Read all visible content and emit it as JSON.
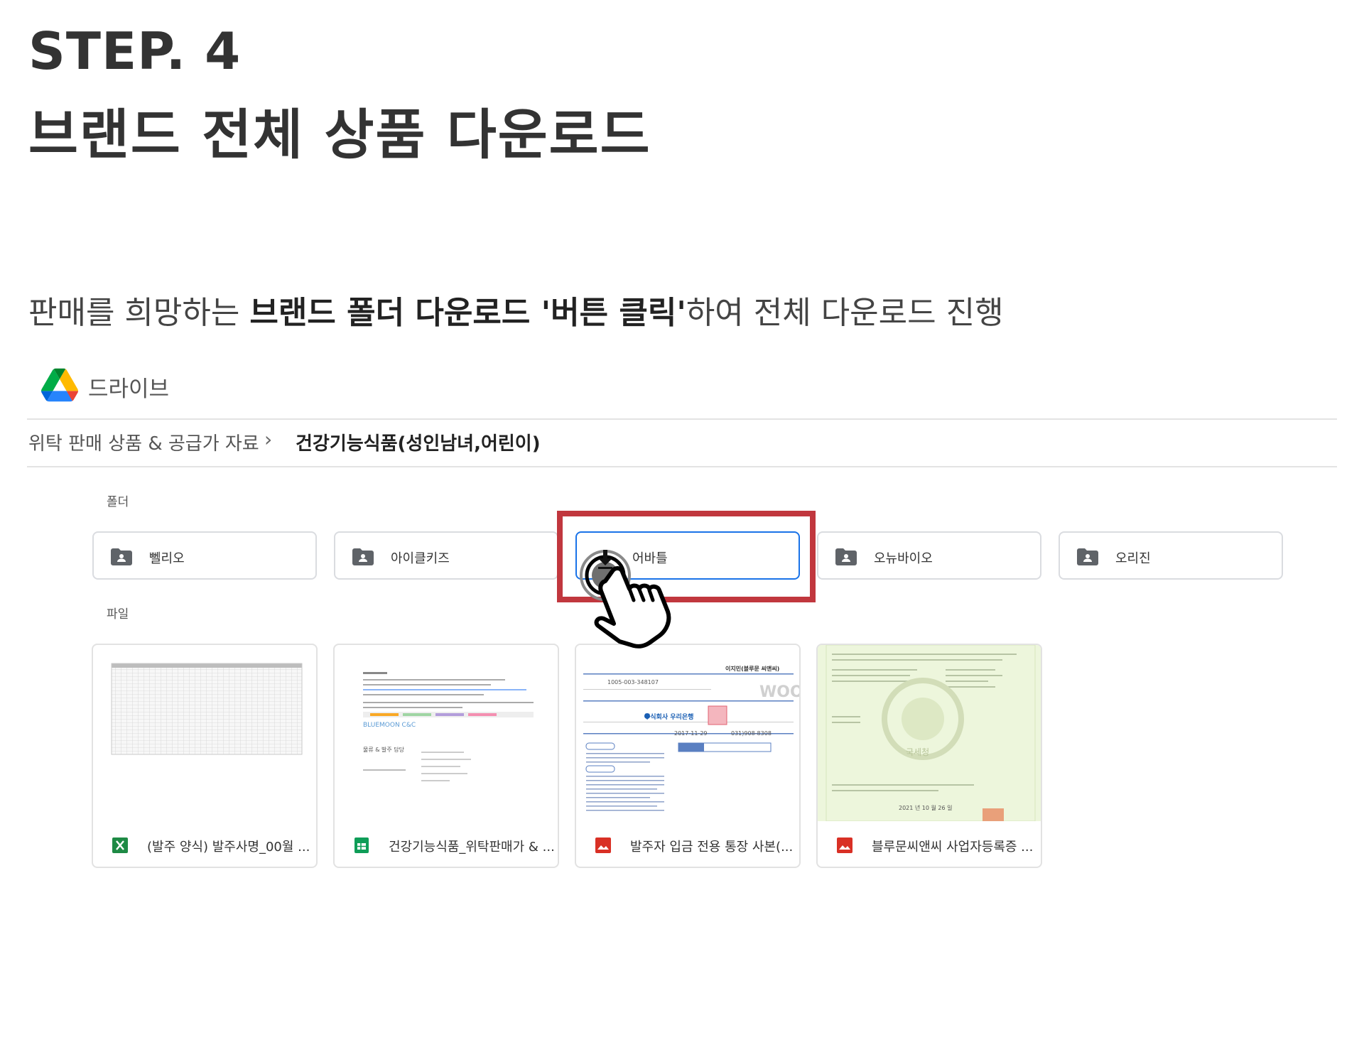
{
  "header": {
    "step": "STEP. 4",
    "title": "브랜드 전체 상품 다운로드",
    "instruction_pre": "판매를 희망하는 ",
    "instruction_bold": "브랜드 폴더 다운로드 '버튼 클릭'",
    "instruction_post": "하여 전체 다운로드 진행"
  },
  "drive": {
    "logo_icon": "google-drive-logo-icon",
    "name": "드라이브",
    "breadcrumb": [
      {
        "label": "위탁 판매 상품 & 공급가 자료"
      },
      {
        "label": "건강기능식품(성인남녀,어린이)"
      }
    ],
    "breadcrumb_separator": "›",
    "folders_heading": "폴더",
    "files_heading": "파일",
    "folders": [
      {
        "name": "뻴리오",
        "icon": "shared-folder-icon"
      },
      {
        "name": "아이클키즈",
        "icon": "shared-folder-icon"
      },
      {
        "name": "어바틀",
        "icon": "shared-folder-icon",
        "active": true
      },
      {
        "name": "오뉴바이오",
        "icon": "shared-folder-icon"
      },
      {
        "name": "오리진",
        "icon": "shared-folder-icon"
      }
    ],
    "files": [
      {
        "name": "(발주 양식) 발주사명_00월 ...",
        "icon": "excel-icon"
      },
      {
        "name": "건강기능식품_위탁판매가 & ...",
        "icon": "google-sheets-icon"
      },
      {
        "name": "발주자 입금 전용 통장 사본(...",
        "icon": "image-file-icon"
      },
      {
        "name": "블루문씨앤씨 사업자등록증 ...",
        "icon": "image-file-icon"
      }
    ]
  },
  "thumbnails": {
    "doc_company": "BLUEMOON C&C",
    "doc_section": "물류 & 발주 담당",
    "bank_name": "주식회사 우리은행",
    "bank_account_no": "1005-003-348107",
    "bank_holder": "이지민(블루문 씨앤씨)",
    "bank_open_date": "2017-11-29",
    "bank_phone": "031)908-8308",
    "bank_logo": "WOORI",
    "cert_date": "2021 년 10 월 26 일",
    "cert_seal": "국세청"
  },
  "overlay": {
    "highlight_color": "#c1373e",
    "cursor_icon": "hand-pointer-click-icon",
    "download_badge_icon": "download-arrow-icon"
  },
  "colors": {
    "text_dark": "#333333",
    "drive_blue": "#1a73e8",
    "excel_green": "#1e8a45",
    "sheets_green": "#0f9d58",
    "image_red": "#d93025"
  }
}
